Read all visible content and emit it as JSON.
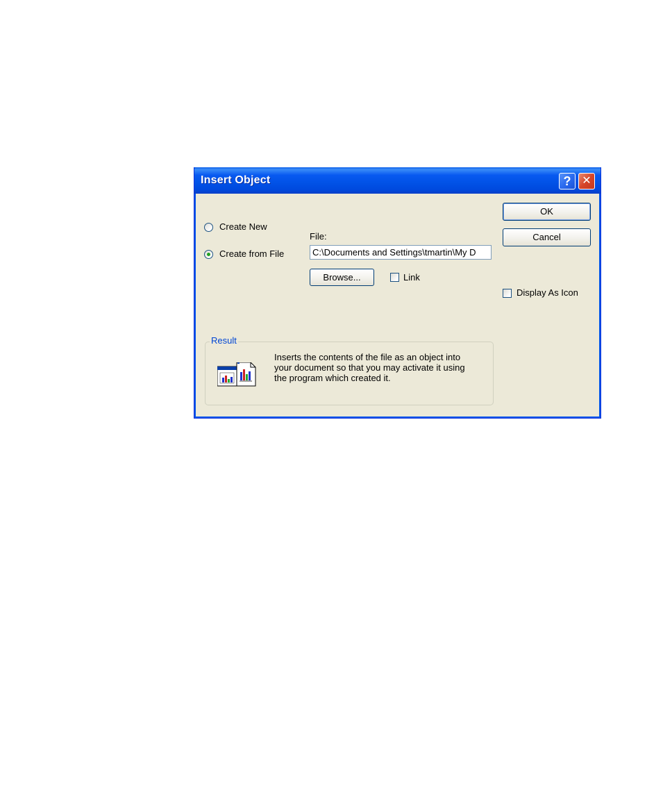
{
  "dialog": {
    "title": "Insert Object",
    "help_glyph": "?",
    "close_glyph": "✕"
  },
  "options": {
    "create_new": "Create New",
    "create_from_file": "Create from File",
    "selected": "create_from_file"
  },
  "file": {
    "label": "File:",
    "value": "C:\\Documents and Settings\\tmartin\\My D"
  },
  "buttons": {
    "ok": "OK",
    "cancel": "Cancel",
    "browse": "Browse..."
  },
  "checkboxes": {
    "link": "Link",
    "display_as_icon": "Display As Icon"
  },
  "result": {
    "legend": "Result",
    "line1": "Inserts the contents of the file as an object into",
    "line2": "your document so that you may activate it using",
    "line3": "the program which created it.",
    "icon": "embedded-object-icon"
  },
  "colors": {
    "titlebar": "#0152e6",
    "dialog_bg": "#ece9d8",
    "radio_dot": "#21a121",
    "group_legend": "#0046d5"
  }
}
